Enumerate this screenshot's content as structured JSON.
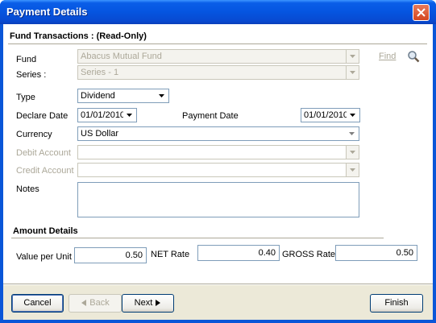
{
  "window": {
    "title": "Payment Details"
  },
  "fund_section": {
    "title": "Fund Transactions : (Read-Only)"
  },
  "fund": {
    "label": "Fund",
    "value": "Abacus Mutual Fund",
    "find_label": "Find"
  },
  "series": {
    "label": "Series :",
    "value": "Series - 1"
  },
  "type": {
    "label": "Type",
    "value": "Dividend"
  },
  "declare_date": {
    "label": "Declare Date",
    "value": "01/01/2010"
  },
  "payment_date": {
    "label": "Payment Date",
    "value": "01/01/2010"
  },
  "currency": {
    "label": "Currency",
    "value": "US Dollar"
  },
  "debit_account": {
    "label": "Debit Account",
    "value": ""
  },
  "credit_account": {
    "label": "Credit Account",
    "value": ""
  },
  "notes": {
    "label": "Notes",
    "value": ""
  },
  "amount_section": {
    "title": "Amount Details"
  },
  "value_per_unit": {
    "label": "Value per Unit",
    "value": "0.50"
  },
  "net_rate": {
    "label": "NET Rate",
    "value": "0.40"
  },
  "gross_rate": {
    "label": "GROSS Rate",
    "value": "0.50"
  },
  "buttons": {
    "cancel": "Cancel",
    "back": "Back",
    "next": "Next",
    "finish": "Finish"
  },
  "icons": {
    "close": "close-icon",
    "search": "magnifier-icon",
    "dropdown": "chevron-down-icon",
    "back": "arrow-left-icon",
    "next": "arrow-right-icon"
  },
  "colors": {
    "titlebar": "#0555e0",
    "dialog_bg": "#ece9d8",
    "field_border": "#7f9db9",
    "disabled_text": "#aca899"
  }
}
